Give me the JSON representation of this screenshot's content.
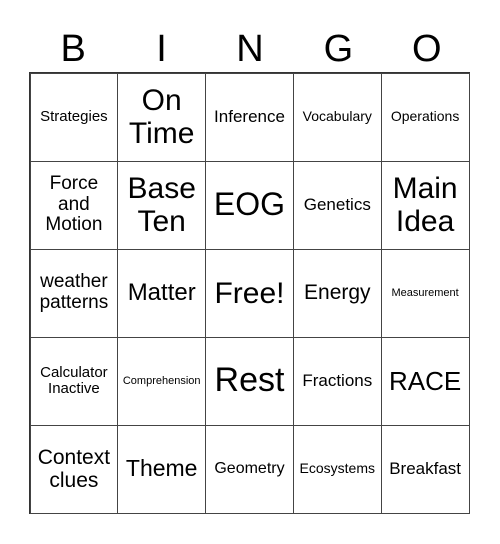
{
  "header": [
    "B",
    "I",
    "N",
    "G",
    "O"
  ],
  "cells": [
    {
      "text": "Strategies",
      "size": 15
    },
    {
      "text": "On Time",
      "size": 30
    },
    {
      "text": "Inference",
      "size": 17
    },
    {
      "text": "Vocabulary",
      "size": 14
    },
    {
      "text": "Operations",
      "size": 14
    },
    {
      "text": "Force and Motion",
      "size": 19
    },
    {
      "text": "Base Ten",
      "size": 30
    },
    {
      "text": "EOG",
      "size": 32
    },
    {
      "text": "Genetics",
      "size": 17
    },
    {
      "text": "Main Idea",
      "size": 30
    },
    {
      "text": "weather patterns",
      "size": 19
    },
    {
      "text": "Matter",
      "size": 24
    },
    {
      "text": "Free!",
      "size": 30
    },
    {
      "text": "Energy",
      "size": 21
    },
    {
      "text": "Measurement",
      "size": 11
    },
    {
      "text": "Calculator Inactive",
      "size": 15
    },
    {
      "text": "Comprehension",
      "size": 11
    },
    {
      "text": "Rest",
      "size": 34
    },
    {
      "text": "Fractions",
      "size": 17
    },
    {
      "text": "RACE",
      "size": 26
    },
    {
      "text": "Context clues",
      "size": 21
    },
    {
      "text": "Theme",
      "size": 23
    },
    {
      "text": "Geometry",
      "size": 16
    },
    {
      "text": "Ecosystems",
      "size": 14
    },
    {
      "text": "Breakfast",
      "size": 17
    }
  ]
}
